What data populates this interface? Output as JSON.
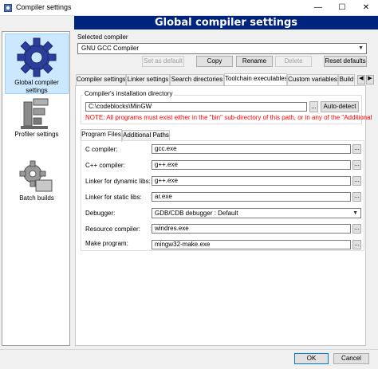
{
  "window": {
    "title": "Compiler settings",
    "controls": {
      "minimize": "—",
      "maximize": "☐",
      "close": "✕"
    }
  },
  "banner": {
    "title": "Global compiler settings"
  },
  "left_panel": {
    "items": [
      {
        "label": "Global compiler settings",
        "icon": "gear-icon",
        "selected": true
      },
      {
        "label": "Profiler settings",
        "icon": "profiler-icon",
        "selected": false
      },
      {
        "label": "Batch builds",
        "icon": "batch-gear-icon",
        "selected": false
      }
    ]
  },
  "compiler_selection": {
    "label": "Selected compiler",
    "value": "GNU GCC Compiler",
    "buttons": {
      "set_default": "Set as default",
      "copy": "Copy",
      "rename": "Rename",
      "delete": "Delete",
      "reset": "Reset defaults"
    }
  },
  "tabs": [
    {
      "label": "Compiler settings"
    },
    {
      "label": "Linker settings"
    },
    {
      "label": "Search directories"
    },
    {
      "label": "Toolchain executables",
      "active": true
    },
    {
      "label": "Custom variables"
    },
    {
      "label": "Build"
    }
  ],
  "toolchain": {
    "install_dir_label": "Compiler's installation directory",
    "install_dir_value": "C:\\codeblocks\\MinGW",
    "browse": "...",
    "auto_detect": "Auto-detect",
    "note": "NOTE: All programs must exist either in the \"bin\" sub-directory of this path, or in any of the \"Additional",
    "subtabs": [
      {
        "label": "Program Files",
        "active": true
      },
      {
        "label": "Additional Paths"
      }
    ],
    "programs": [
      {
        "label": "C compiler:",
        "value": "gcc.exe"
      },
      {
        "label": "C++ compiler:",
        "value": "g++.exe"
      },
      {
        "label": "Linker for dynamic libs:",
        "value": "g++.exe"
      },
      {
        "label": "Linker for static libs:",
        "value": "ar.exe"
      },
      {
        "label": "Debugger:",
        "value": "GDB/CDB debugger : Default"
      },
      {
        "label": "Resource compiler:",
        "value": "windres.exe"
      },
      {
        "label": "Make program:",
        "value": "mingw32-make.exe"
      }
    ]
  },
  "footer": {
    "ok": "OK",
    "cancel": "Cancel"
  },
  "tab_scroll": {
    "left": "◀",
    "right": "▶"
  },
  "colors": {
    "banner": "#00247d",
    "note": "#ff0000",
    "selection": "#cce8ff"
  }
}
